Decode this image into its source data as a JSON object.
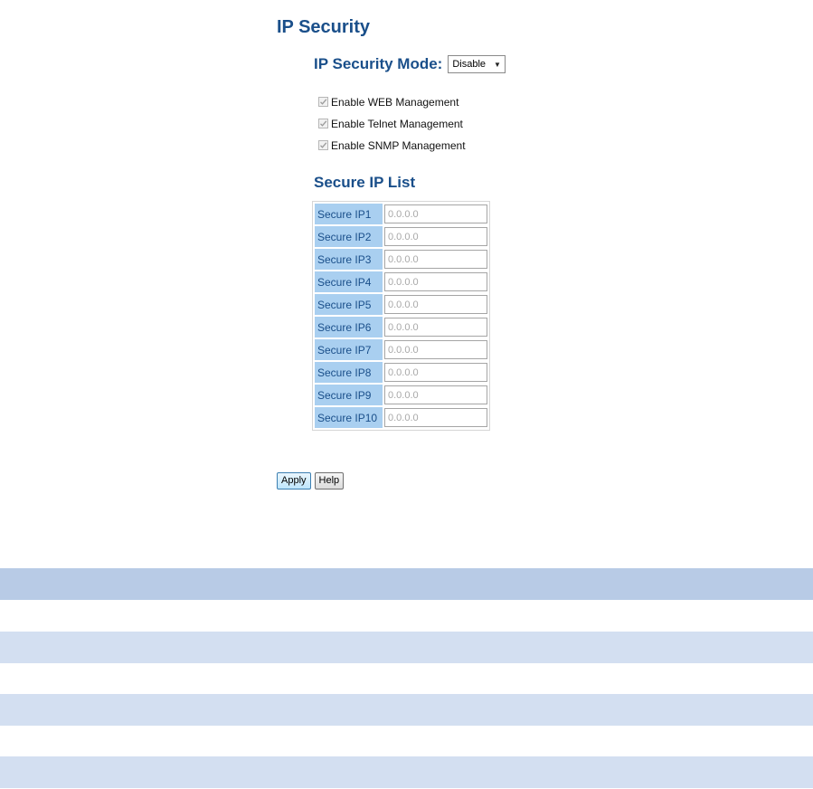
{
  "page": {
    "title": "IP Security"
  },
  "mode": {
    "label": "IP Security Mode:",
    "selected": "Disable"
  },
  "management": [
    {
      "label": "Enable WEB Management",
      "checked": true
    },
    {
      "label": "Enable Telnet Management",
      "checked": true
    },
    {
      "label": "Enable SNMP Management",
      "checked": true
    }
  ],
  "secure_list": {
    "title": "Secure IP List",
    "rows": [
      {
        "label": "Secure IP1",
        "placeholder": "0.0.0.0"
      },
      {
        "label": "Secure IP2",
        "placeholder": "0.0.0.0"
      },
      {
        "label": "Secure IP3",
        "placeholder": "0.0.0.0"
      },
      {
        "label": "Secure IP4",
        "placeholder": "0.0.0.0"
      },
      {
        "label": "Secure IP5",
        "placeholder": "0.0.0.0"
      },
      {
        "label": "Secure IP6",
        "placeholder": "0.0.0.0"
      },
      {
        "label": "Secure IP7",
        "placeholder": "0.0.0.0"
      },
      {
        "label": "Secure IP8",
        "placeholder": "0.0.0.0"
      },
      {
        "label": "Secure IP9",
        "placeholder": "0.0.0.0"
      },
      {
        "label": "Secure IP10",
        "placeholder": "0.0.0.0"
      }
    ]
  },
  "buttons": {
    "apply": "Apply",
    "help": "Help"
  },
  "colors": {
    "heading": "#1a4f8a",
    "label_cell": "#a9cff0",
    "band_dark": "#b8cbe6",
    "band_light": "#d3dff1"
  }
}
